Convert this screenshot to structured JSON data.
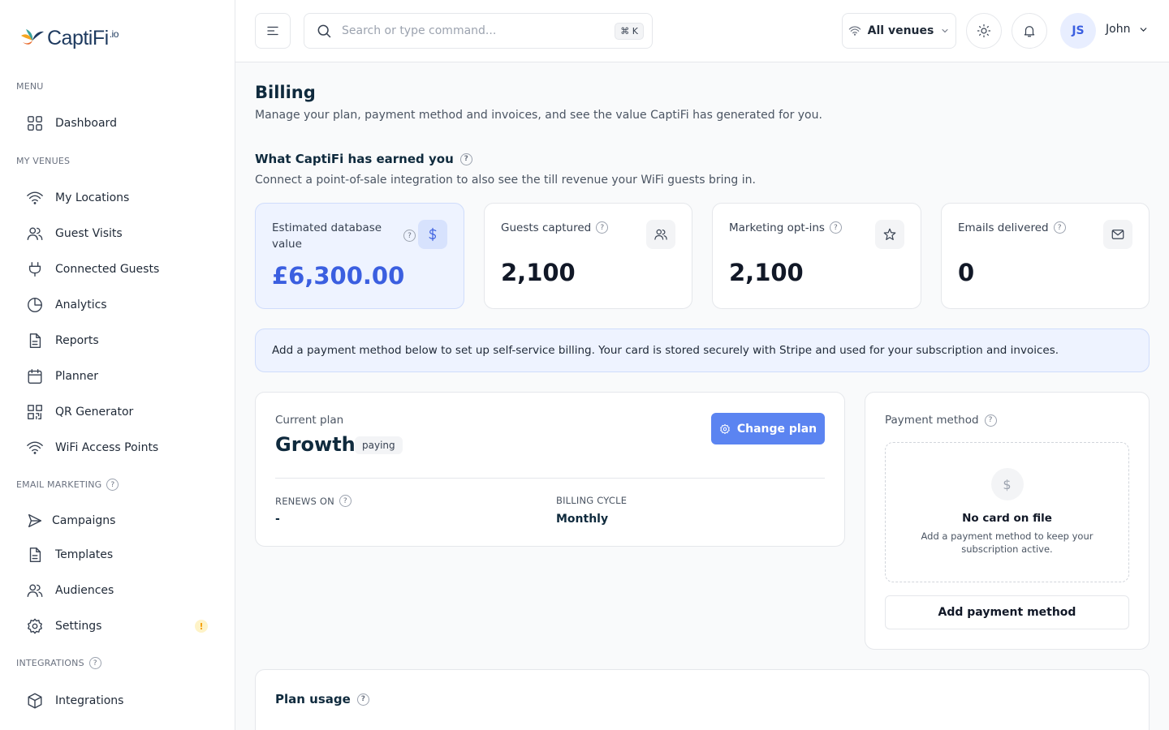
{
  "brand": {
    "name": "CaptiFi",
    "suffix": ".io"
  },
  "sidebar": {
    "sections": {
      "menu": "MENU",
      "my_venues": "MY VENUES",
      "email_marketing": "EMAIL MARKETING",
      "integrations": "INTEGRATIONS"
    },
    "items": {
      "dashboard": "Dashboard",
      "my_locations": "My Locations",
      "guest_visits": "Guest Visits",
      "connected_guests": "Connected Guests",
      "analytics": "Analytics",
      "reports": "Reports",
      "planner": "Planner",
      "qr_generator": "QR Generator",
      "wifi_access_points": "WiFi Access Points",
      "campaigns": "Campaigns",
      "templates": "Templates",
      "audiences": "Audiences",
      "settings": "Settings",
      "integrations": "Integrations"
    },
    "settings_alert": "!",
    "help_glyph": "?"
  },
  "topbar": {
    "search_placeholder": "Search or type command...",
    "shortcut": "⌘ K",
    "venue_filter": "All venues",
    "avatar_initials": "JS",
    "user_name": "John"
  },
  "page": {
    "title": "Billing",
    "subtitle": "Manage your plan, payment method and invoices, and see the value CaptiFi has generated for you."
  },
  "earned": {
    "title": "What CaptiFi has earned you",
    "subtitle": "Connect a point-of-sale integration to also see the till revenue your WiFi guests bring in.",
    "cards": [
      {
        "label": "Estimated database value",
        "value": "£6,300.00",
        "icon": "dollar-icon"
      },
      {
        "label": "Guests captured",
        "value": "2,100",
        "icon": "users-icon"
      },
      {
        "label": "Marketing opt-ins",
        "value": "2,100",
        "icon": "star-icon"
      },
      {
        "label": "Emails delivered",
        "value": "0",
        "icon": "mail-icon"
      }
    ]
  },
  "banner": {
    "text": "Add a payment method below to set up self-service billing. Your card is stored securely with Stripe and used for your subscription and invoices."
  },
  "plan": {
    "label": "Current plan",
    "name": "Growth",
    "status": "paying",
    "change_button": "Change plan",
    "renews_label": "RENEWS ON",
    "renews_value": "-",
    "cycle_label": "BILLING CYCLE",
    "cycle_value": "Monthly"
  },
  "payment": {
    "title": "Payment method",
    "empty_glyph": "$",
    "empty_title": "No card on file",
    "empty_sub": "Add a payment method to keep your subscription active.",
    "add_button": "Add payment method"
  },
  "usage": {
    "title": "Plan usage"
  },
  "colors": {
    "accent": "#5b84f1",
    "accent_text": "#3b5fe0",
    "highlight_bg": "#eef3ff",
    "warning": "#f59e0b"
  }
}
